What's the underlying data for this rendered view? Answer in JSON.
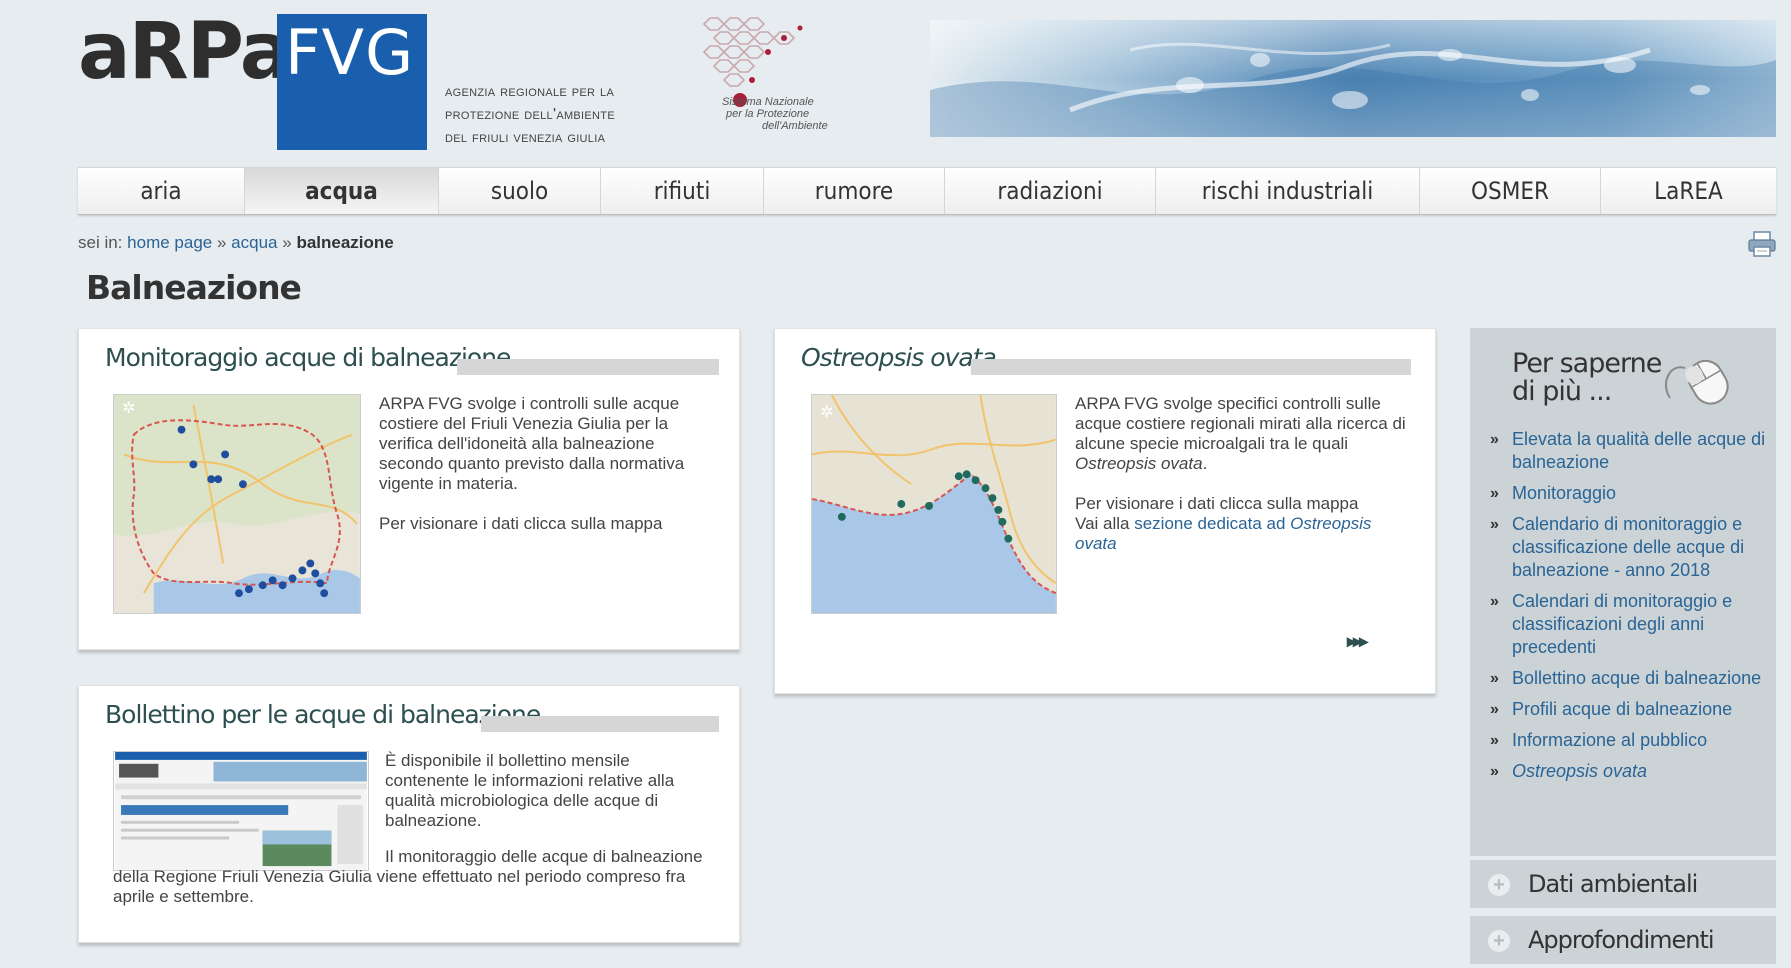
{
  "header": {
    "logo_left": "aRPa",
    "logo_right": "FVG",
    "agency_lines": [
      "agenzia regionale per la",
      "protezione dell'ambiente",
      "del friuli venezia giulia"
    ],
    "snpa_lines": [
      "Sistema Nazionale",
      "per la Protezione",
      "dell'Ambiente"
    ],
    "brand_color": "#1a5fae"
  },
  "nav": {
    "items": [
      {
        "label": "aria"
      },
      {
        "label": "acqua",
        "active": true
      },
      {
        "label": "suolo"
      },
      {
        "label": "rifiuti"
      },
      {
        "label": "rumore"
      },
      {
        "label": "radiazioni"
      },
      {
        "label": "rischi industriali"
      },
      {
        "label": "OSMER"
      },
      {
        "label": "LaREA"
      }
    ]
  },
  "breadcrumb": {
    "prefix": "sei in:",
    "home": "home page",
    "sep": "»",
    "section": "acqua",
    "current": "balneazione"
  },
  "page_title": "Balneazione",
  "cards": {
    "monitoraggio": {
      "title": "Monitoraggio acque di balneazione",
      "text": "ARPA FVG svolge i controlli sulle acque costiere del Friuli Venezia Giulia per la verifica dell'idoneità alla balneazione secondo quanto previsto dalla normativa vigente in materia.",
      "cta": "Per visionare i dati clicca sulla mappa"
    },
    "ostreopsis": {
      "title": "Ostreopsis ovata",
      "text_pre": "ARPA FVG svolge specifici controlli sulle acque costiere regionali mirati alla ricerca di alcune specie microalgali tra le quali ",
      "text_em": "Ostreopsis ovata",
      "text_post": ".",
      "cta": "Per visionare i dati clicca sulla mappa",
      "link_pre": "Vai alla ",
      "link_text": "sezione dedicata ad ",
      "link_em": "Ostreopsis ovata",
      "more": "▸▸▸"
    },
    "bollettino": {
      "title": "Bollettino per le acque di balneazione",
      "text1": "È disponibile il bollettino mensile contenente le informazioni relative alla qualità microbiologica delle acque di balneazione.",
      "text2": "Il monitoraggio delle acque di balneazione della Regione Friuli Venezia Giulia  viene effettuato nel periodo compreso fra aprile  e settembre."
    }
  },
  "sidebar": {
    "title_line1": "Per saperne",
    "title_line2": "di più ...",
    "bullet": "»",
    "links": [
      {
        "label": "Elevata la qualità delle acque di balneazione"
      },
      {
        "label": "Monitoraggio"
      },
      {
        "label": "Calendario di monitoraggio e classificazione delle acque di balneazione - anno 2018"
      },
      {
        "label": "Calendari di monitoraggio e classificazioni degli anni precedenti"
      },
      {
        "label": "Bollettino acque di balneazione"
      },
      {
        "label": "Profili acque di balneazione"
      },
      {
        "label": "Informazione al pubblico"
      },
      {
        "label": "Ostreopsis ovata",
        "italic": true
      }
    ],
    "sections": [
      {
        "label": "Dati ambientali",
        "icon": "plus-icon"
      },
      {
        "label": "Approfondimenti",
        "icon": "plus-icon"
      }
    ]
  }
}
